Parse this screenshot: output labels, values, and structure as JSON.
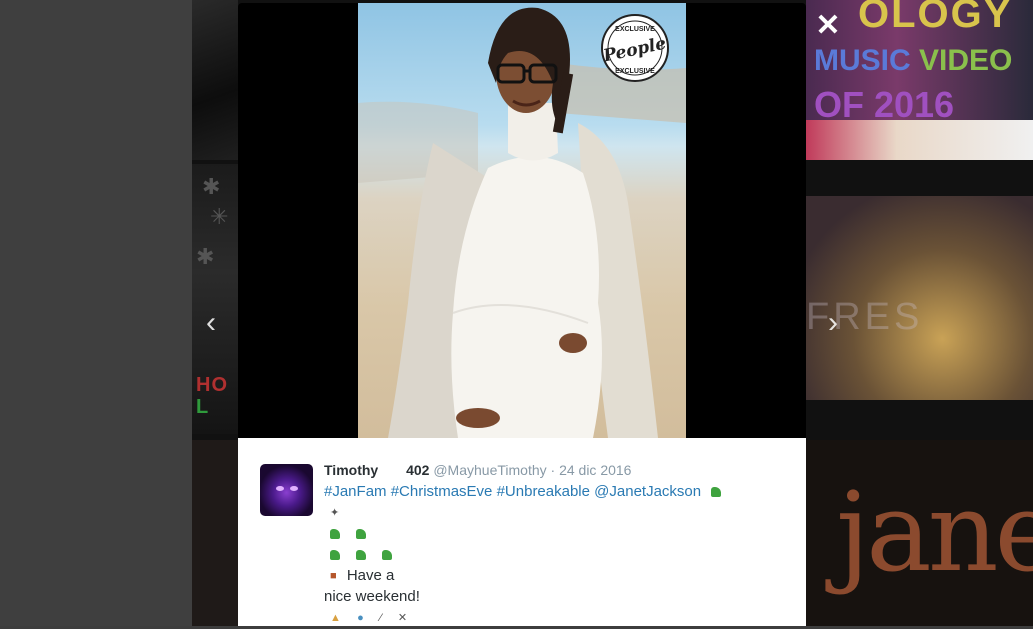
{
  "background": {
    "tile_texts": {
      "left_holiday_line1": "HO",
      "left_holiday_line2": "L",
      "right_top_line1": "OLOGY",
      "right_top_line2a": "MUSIC ",
      "right_top_line2b": "VIDEO",
      "right_top_line3": "OF 2016",
      "right_mid_text": "FRES",
      "right_bottom_text": "jane"
    },
    "nav_prev_icon": "‹",
    "nav_next_icon": "›"
  },
  "modal": {
    "close_icon": "✕",
    "photo": {
      "badge_top": "EXCLUSIVE",
      "badge_main": "People",
      "badge_bottom": "EXCLUSIVE"
    },
    "tweet": {
      "display_name": "Timothy",
      "count": "402",
      "handle_date": "@MayhueTimothy · 24 dic 2016",
      "hashtags": [
        "#JanFam",
        "#ChristmasEve",
        "#Unbreakable",
        "@JanetJackson"
      ],
      "line_have_a": "Have a",
      "line_weekend": "nice weekend!"
    }
  },
  "colors": {
    "link": "#2a7ab3",
    "name": "#292f33",
    "meta": "#8899a6"
  }
}
